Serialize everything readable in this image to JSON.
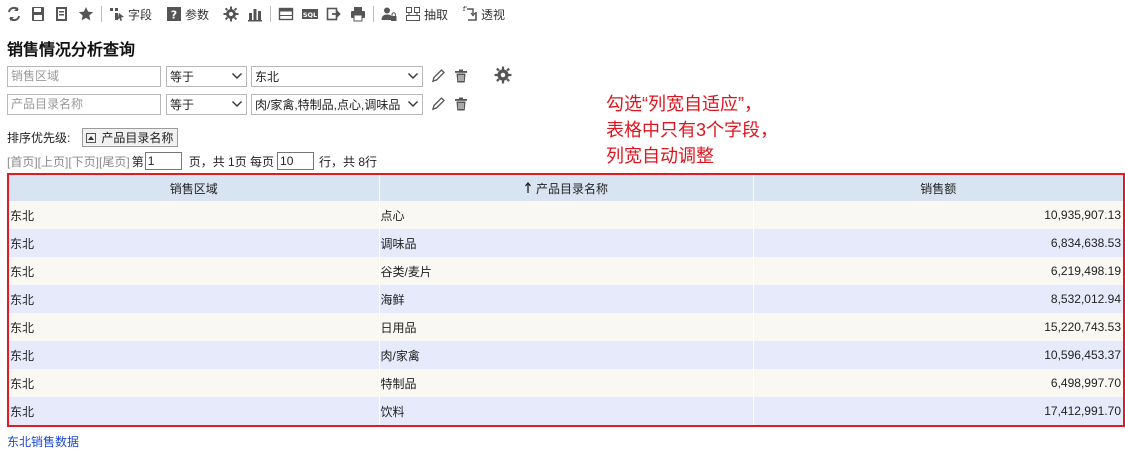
{
  "toolbar": {
    "field_label": "字段",
    "param_label": "参数",
    "extract_label": "抽取",
    "pivot_label": "透视",
    "sql_label": "SQL"
  },
  "page": {
    "title": "销售情况分析查询"
  },
  "filters": [
    {
      "field_placeholder": "销售区域",
      "operator": "等于",
      "value": "东北"
    },
    {
      "field_placeholder": "产品目录名称",
      "operator": "等于",
      "value": "肉/家禽,特制品,点心,调味品"
    }
  ],
  "sort": {
    "label": "排序优先级:",
    "chip": "产品目录名称"
  },
  "pager": {
    "first": "[首页]",
    "prev": "[上页]",
    "next": "[下页]",
    "last": "[尾页]",
    "page_prefix": "第",
    "page_value": "1",
    "page_suffix": "页，共 1页 每页",
    "per_page_value": "10",
    "rows_suffix": "行，共 8行"
  },
  "annotation": "勾选“列宽自适应”，\n表格中只有3个字段，\n列宽自动调整",
  "table": {
    "columns": [
      "销售区域",
      "产品目录名称",
      "销售额"
    ],
    "rows": [
      [
        "东北",
        "点心",
        "10,935,907.13"
      ],
      [
        "东北",
        "调味品",
        "6,834,638.53"
      ],
      [
        "东北",
        "谷类/麦片",
        "6,219,498.19"
      ],
      [
        "东北",
        "海鲜",
        "8,532,012.94"
      ],
      [
        "东北",
        "日用品",
        "15,220,743.53"
      ],
      [
        "东北",
        "肉/家禽",
        "10,596,453.37"
      ],
      [
        "东北",
        "特制品",
        "6,498,997.70"
      ],
      [
        "东北",
        "饮料",
        "17,412,991.70"
      ]
    ]
  },
  "footer": {
    "link": "东北销售数据"
  },
  "colors": {
    "accent_red": "#e01b24",
    "header_bg": "#d9e4f3",
    "row_alt": "#e6eafa",
    "row_base": "#f9f8f2",
    "link_blue": "#1c48d0"
  }
}
